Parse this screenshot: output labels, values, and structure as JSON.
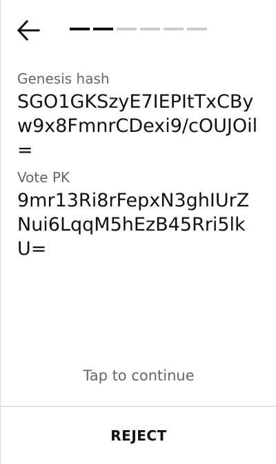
{
  "header": {
    "back_icon": "arrow-left-icon",
    "progress": {
      "total_steps": 6,
      "completed_steps": 2
    }
  },
  "fields": [
    {
      "label": "Genesis hash",
      "value": "SGO1GKSzyE7IEPItTxCByw9x8FmnrCDexi9/cOUJOil="
    },
    {
      "label": "Vote PK",
      "value": "9mr13Ri8rFepxN3ghIUrZNui6LqqM5hEzB45Rri5lkU="
    }
  ],
  "footer": {
    "tap_hint": "Tap to continue",
    "reject_label": "REJECT"
  },
  "colors": {
    "text": "#111111",
    "muted": "#666666",
    "progress_active": "#111111",
    "progress_inactive": "#cccccc",
    "divider": "#cfcfcf"
  }
}
